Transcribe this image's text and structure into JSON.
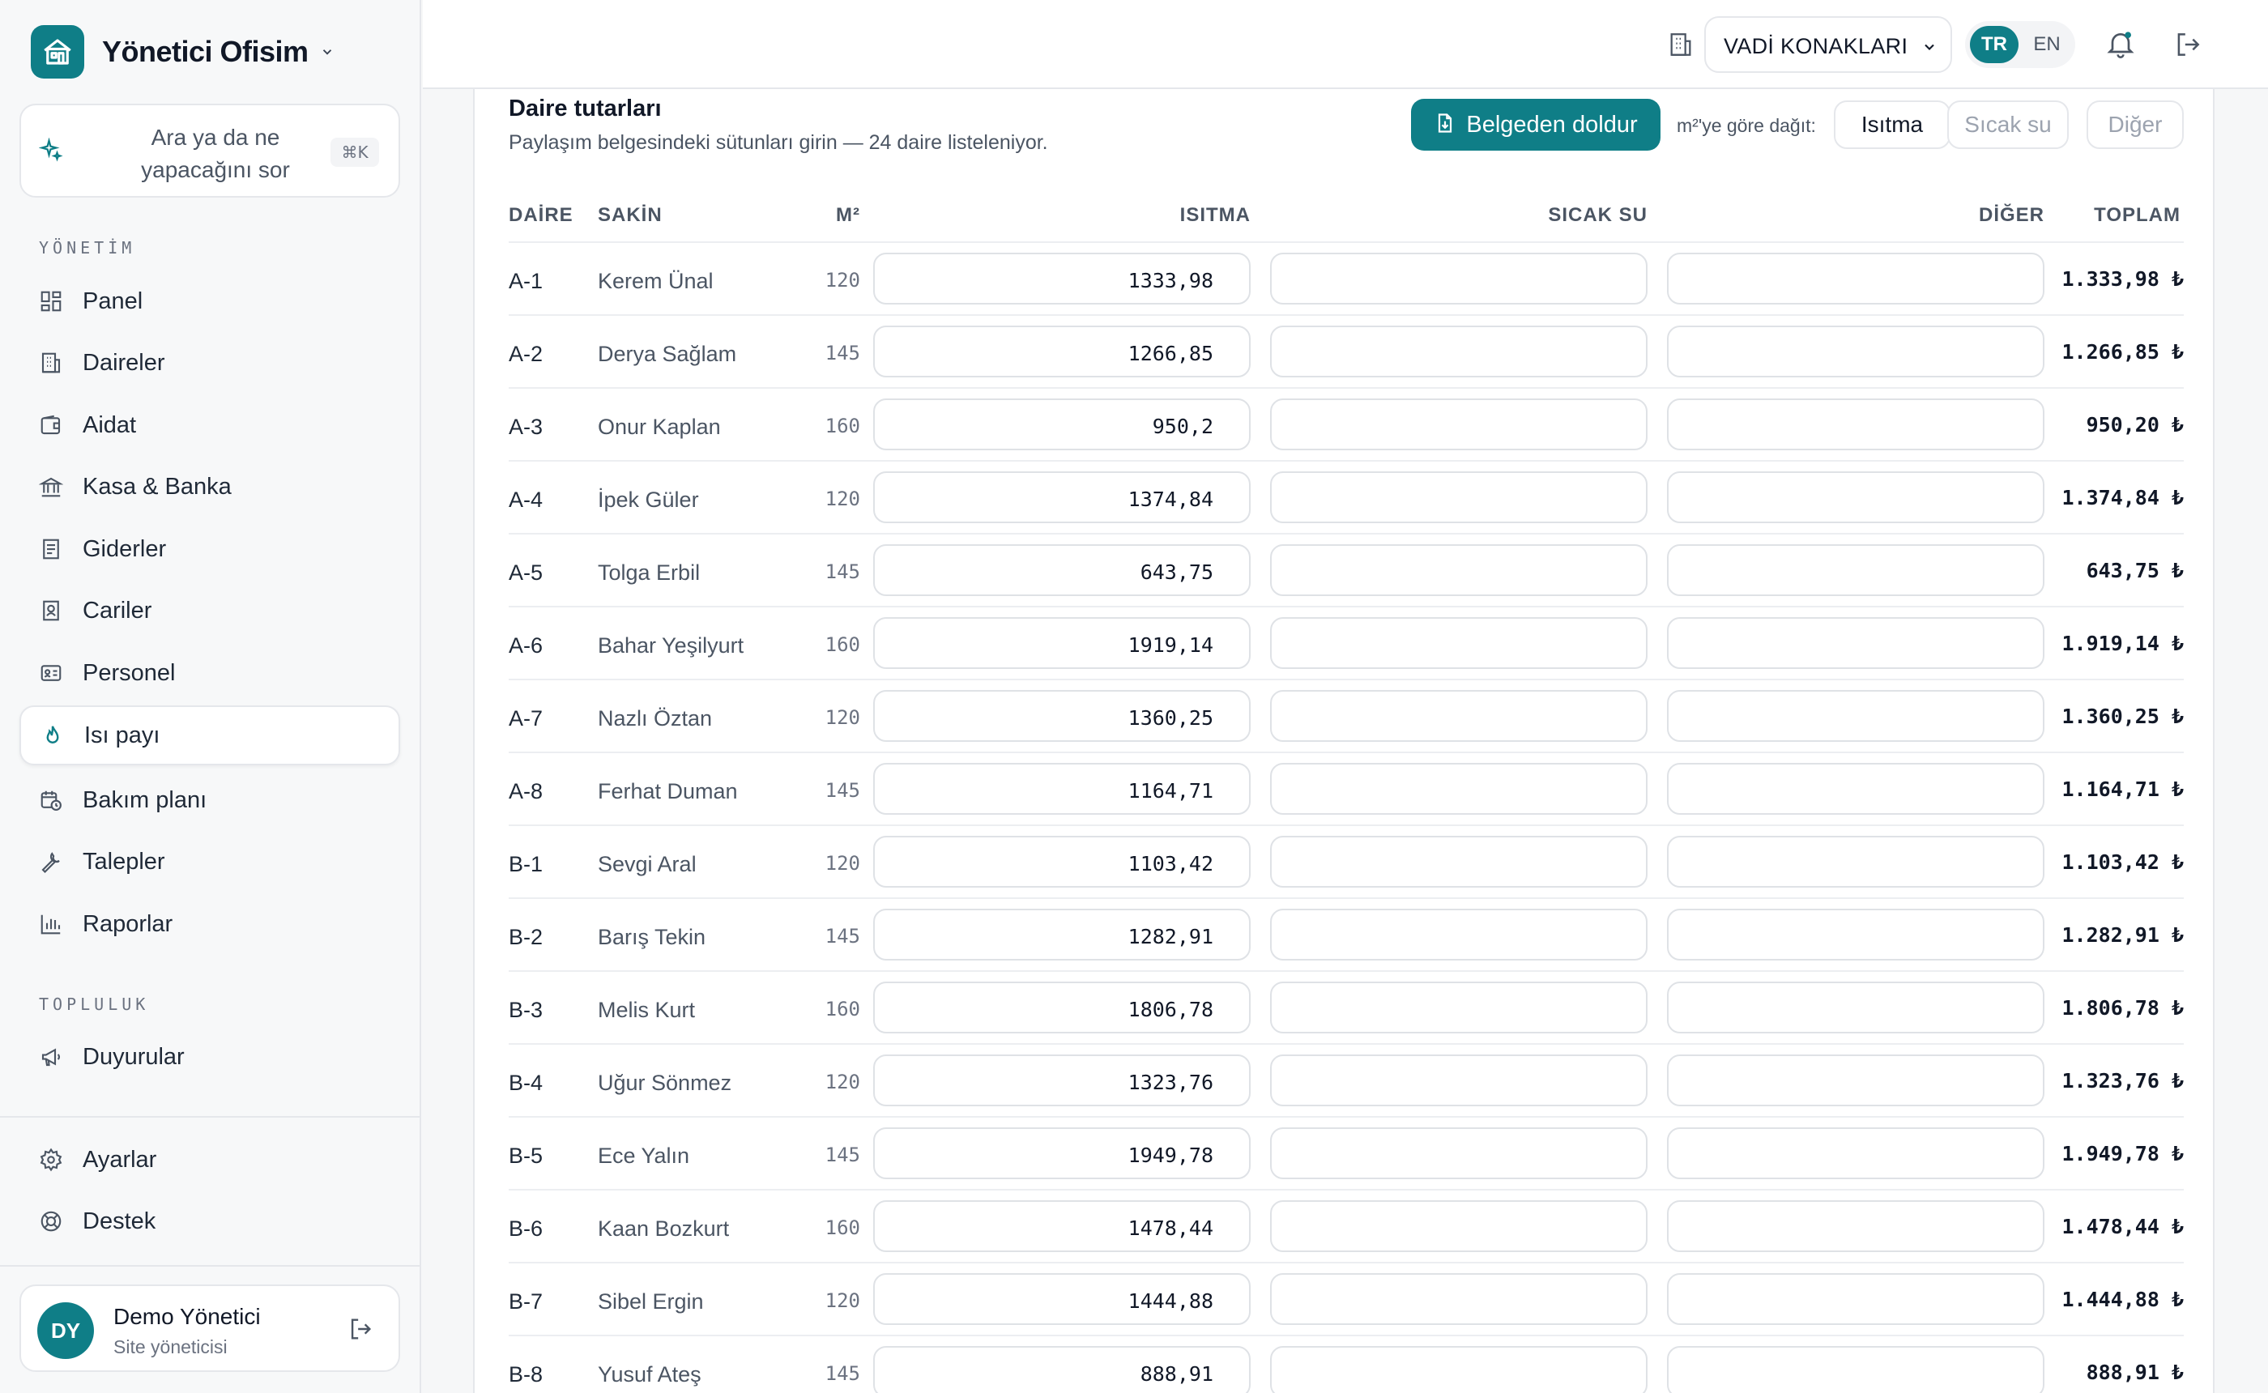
{
  "app": {
    "name": "Yönetici Ofisim"
  },
  "ask": {
    "text": "Ara ya da ne yapacağını sor",
    "shortcut": "⌘K"
  },
  "sidebar": {
    "section_management": "YÖNETİM",
    "section_community": "TOPLULUK",
    "items": [
      {
        "label": "Panel",
        "icon": "grid-icon"
      },
      {
        "label": "Daireler",
        "icon": "building-icon"
      },
      {
        "label": "Aidat",
        "icon": "wallet-icon"
      },
      {
        "label": "Kasa & Banka",
        "icon": "bank-icon"
      },
      {
        "label": "Giderler",
        "icon": "receipt-icon"
      },
      {
        "label": "Cariler",
        "icon": "contact-icon"
      },
      {
        "label": "Personel",
        "icon": "id-card-icon"
      },
      {
        "label": "Isı payı",
        "icon": "flame-icon",
        "active": true
      },
      {
        "label": "Bakım planı",
        "icon": "calendar-clock-icon"
      },
      {
        "label": "Talepler",
        "icon": "wrench-icon"
      },
      {
        "label": "Raporlar",
        "icon": "bar-chart-icon"
      }
    ],
    "community_items": [
      {
        "label": "Duyurular",
        "icon": "megaphone-icon"
      }
    ],
    "bottom_items": [
      {
        "label": "Ayarlar",
        "icon": "gear-icon"
      },
      {
        "label": "Destek",
        "icon": "lifebuoy-icon"
      }
    ]
  },
  "user": {
    "initials": "DY",
    "name": "Demo Yönetici",
    "role": "Site yöneticisi"
  },
  "topbar": {
    "site": "VADİ KONAKLARI",
    "lang_active": "TR",
    "lang_other": "EN"
  },
  "panel": {
    "title": "Daire tutarları",
    "subtitle": "Paylaşım belgesindeki sütunları girin — 24 daire listeleniyor.",
    "fill_button": "Belgeden doldur",
    "distribute_label": "m²'ye göre dağıt:",
    "chips": [
      "Isıtma",
      "Sıcak su",
      "Diğer"
    ]
  },
  "table": {
    "headers": {
      "unit": "DAİRE",
      "resident": "SAKİN",
      "area": "M²",
      "heating": "ISITMA",
      "hot_water": "SICAK SU",
      "other": "DİĞER",
      "total": "TOPLAM"
    },
    "rows": [
      {
        "unit": "A-1",
        "resident": "Kerem Ünal",
        "m2": "120",
        "heating": "1333,98",
        "total": "1.333,98 ₺"
      },
      {
        "unit": "A-2",
        "resident": "Derya Sağlam",
        "m2": "145",
        "heating": "1266,85",
        "total": "1.266,85 ₺"
      },
      {
        "unit": "A-3",
        "resident": "Onur Kaplan",
        "m2": "160",
        "heating": "950,2",
        "total": "950,20 ₺"
      },
      {
        "unit": "A-4",
        "resident": "İpek Güler",
        "m2": "120",
        "heating": "1374,84",
        "total": "1.374,84 ₺"
      },
      {
        "unit": "A-5",
        "resident": "Tolga Erbil",
        "m2": "145",
        "heating": "643,75",
        "total": "643,75 ₺"
      },
      {
        "unit": "A-6",
        "resident": "Bahar Yeşilyurt",
        "m2": "160",
        "heating": "1919,14",
        "total": "1.919,14 ₺"
      },
      {
        "unit": "A-7",
        "resident": "Nazlı Öztan",
        "m2": "120",
        "heating": "1360,25",
        "total": "1.360,25 ₺"
      },
      {
        "unit": "A-8",
        "resident": "Ferhat Duman",
        "m2": "145",
        "heating": "1164,71",
        "total": "1.164,71 ₺"
      },
      {
        "unit": "B-1",
        "resident": "Sevgi Aral",
        "m2": "120",
        "heating": "1103,42",
        "total": "1.103,42 ₺"
      },
      {
        "unit": "B-2",
        "resident": "Barış Tekin",
        "m2": "145",
        "heating": "1282,91",
        "total": "1.282,91 ₺"
      },
      {
        "unit": "B-3",
        "resident": "Melis Kurt",
        "m2": "160",
        "heating": "1806,78",
        "total": "1.806,78 ₺"
      },
      {
        "unit": "B-4",
        "resident": "Uğur Sönmez",
        "m2": "120",
        "heating": "1323,76",
        "total": "1.323,76 ₺"
      },
      {
        "unit": "B-5",
        "resident": "Ece Yalın",
        "m2": "145",
        "heating": "1949,78",
        "total": "1.949,78 ₺"
      },
      {
        "unit": "B-6",
        "resident": "Kaan Bozkurt",
        "m2": "160",
        "heating": "1478,44",
        "total": "1.478,44 ₺"
      },
      {
        "unit": "B-7",
        "resident": "Sibel Ergin",
        "m2": "120",
        "heating": "1444,88",
        "total": "1.444,88 ₺"
      },
      {
        "unit": "B-8",
        "resident": "Yusuf Ateş",
        "m2": "145",
        "heating": "888,91",
        "total": "888,91 ₺"
      }
    ]
  },
  "colors": {
    "accent": "#0f7e87",
    "border": "#e5e7eb",
    "sidebar_bg": "#f7f8f9"
  }
}
